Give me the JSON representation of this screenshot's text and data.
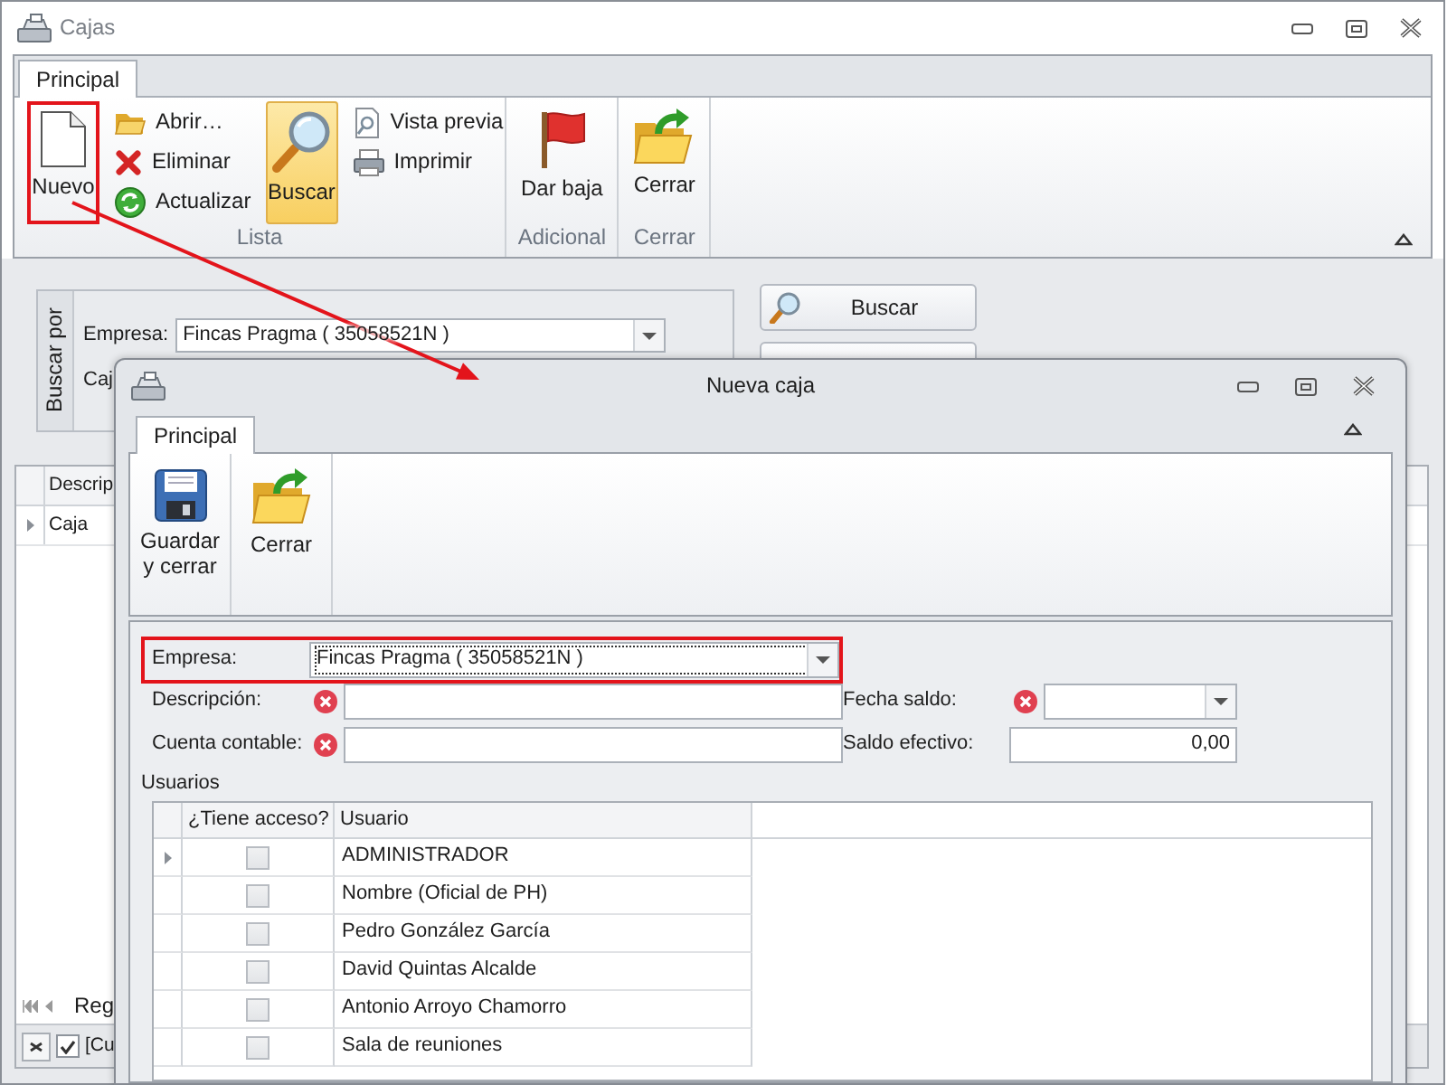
{
  "main_window": {
    "title": "Cajas",
    "tabs": [
      {
        "label": "Principal",
        "selected": true
      }
    ],
    "ribbon_groups": [
      {
        "label": "Lista",
        "columns": [
          {
            "kind": "large",
            "buttons": [
              {
                "label": "Nuevo",
                "pressed": false,
                "annotated": true
              }
            ]
          },
          {
            "kind": "small",
            "buttons": [
              {
                "label": "Abrir…",
                "pressed": false,
                "annotated": false
              },
              {
                "label": "Eliminar",
                "pressed": false,
                "annotated": false
              },
              {
                "label": "Actualizar",
                "pressed": false,
                "annotated": false
              }
            ]
          },
          {
            "kind": "large",
            "buttons": [
              {
                "label": "Buscar",
                "pressed": true,
                "annotated": false
              }
            ]
          },
          {
            "kind": "small",
            "buttons": [
              {
                "label": "Vista previa",
                "pressed": false,
                "annotated": false
              },
              {
                "label": "Imprimir",
                "pressed": false,
                "annotated": false
              }
            ]
          }
        ]
      },
      {
        "label": "Adicional",
        "columns": [
          {
            "kind": "large",
            "buttons": [
              {
                "label": "Dar baja",
                "pressed": false,
                "annotated": false
              }
            ]
          }
        ]
      },
      {
        "label": "Cerrar",
        "columns": [
          {
            "kind": "large",
            "buttons": [
              {
                "label": "Cerrar",
                "pressed": false,
                "annotated": false
              }
            ]
          }
        ]
      }
    ],
    "search_panel": {
      "caption": "Buscar por",
      "fields": [
        {
          "label": "Empresa:",
          "value": "Fincas Pragma ( 35058521N )"
        },
        {
          "label": "Caj"
        }
      ],
      "buttons": [
        {
          "label": "Buscar"
        }
      ]
    },
    "grid": {
      "columns": [
        "Descrip"
      ],
      "rows": [
        {
          "cells": [
            "Caja"
          ],
          "current": true
        }
      ]
    },
    "navigator": {
      "text": "Reg"
    },
    "filter_bar": {
      "checked": true,
      "text": "[Cu"
    }
  },
  "dialog": {
    "title": "Nueva caja",
    "tabs": [
      {
        "label": "Principal",
        "selected": true
      }
    ],
    "ribbon_buttons": [
      {
        "label": "Guardar y cerrar"
      },
      {
        "label": "Cerrar"
      }
    ],
    "form_rows": [
      [
        {
          "label": "Empresa:",
          "kind": "combo",
          "value": "Fincas Pragma ( 35058521N )",
          "error": false,
          "focused": true,
          "annotated": true
        }
      ],
      [
        {
          "label": "Descripción:",
          "kind": "text",
          "error": true,
          "focused": false,
          "annotated": false
        },
        {
          "label": "Fecha saldo:",
          "kind": "combo",
          "error": true,
          "focused": false,
          "annotated": false
        }
      ],
      [
        {
          "label": "Cuenta contable:",
          "kind": "text",
          "error": true,
          "focused": false,
          "annotated": false
        },
        {
          "label": "Saldo efectivo:",
          "kind": "number",
          "value": "0,00",
          "error": false,
          "focused": false,
          "annotated": false
        }
      ]
    ],
    "users": {
      "title": "Usuarios",
      "columns": [
        "¿Tiene acceso?",
        "Usuario"
      ],
      "rows": [
        {
          "has_access": false,
          "user": "ADMINISTRADOR",
          "current": true
        },
        {
          "has_access": false,
          "user": "Nombre (Oficial de PH)",
          "current": false
        },
        {
          "has_access": false,
          "user": "Pedro González García",
          "current": false
        },
        {
          "has_access": false,
          "user": "David Quintas Alcalde",
          "current": false
        },
        {
          "has_access": false,
          "user": "Antonio Arroyo Chamorro",
          "current": false
        },
        {
          "has_access": false,
          "user": "Sala de reuniones",
          "current": false
        }
      ]
    }
  }
}
